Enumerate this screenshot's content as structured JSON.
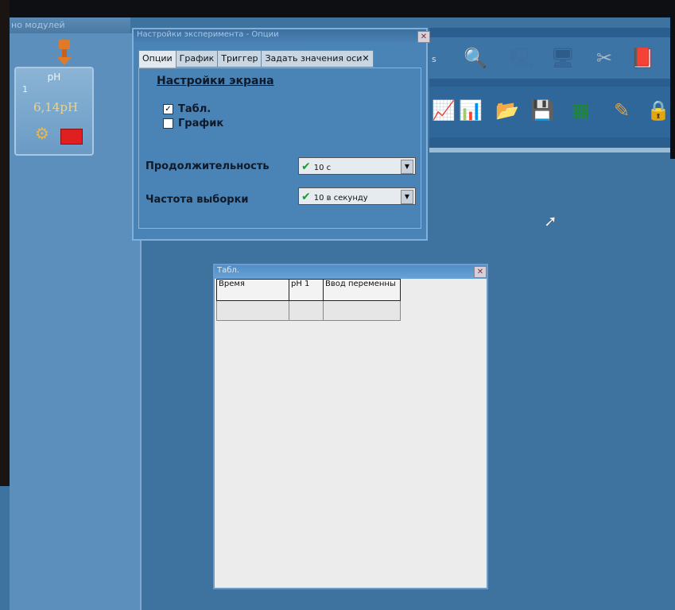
{
  "modules_panel": {
    "title": "но модулей",
    "sensor": {
      "name": "pH",
      "channel": "1",
      "value": "6,14pH"
    }
  },
  "options_dialog": {
    "title": "Настройки эксперимента - Опции",
    "tabs": [
      {
        "label": "Опции",
        "active": true
      },
      {
        "label": "График",
        "active": false
      },
      {
        "label": "Триггер",
        "active": false
      },
      {
        "label": "Задать значения оси",
        "active": false
      }
    ],
    "screen_settings": {
      "heading": "Настройки экрана",
      "table_option": {
        "label": "Табл.",
        "checked": true
      },
      "graph_option": {
        "label": "График",
        "checked": false
      }
    },
    "duration": {
      "label": "Продолжительность",
      "value": "10 с"
    },
    "sample_rate": {
      "label": "Частота выборки",
      "value": "10 в секунду"
    }
  },
  "toolbar": {
    "partial_label": "s",
    "icons": [
      "sensor-search-icon",
      "network-computer-icon",
      "monitor-network-icon",
      "tools-icon",
      "book-icon",
      "chart-icon",
      "chart-marker-icon",
      "open-folder-icon",
      "save-chart-icon",
      "excel-export-icon",
      "chart-eraser-icon",
      "lock-icon"
    ]
  },
  "table_window": {
    "title": "Табл.",
    "columns": [
      "Время",
      "pH 1",
      "Ввод переменны"
    ],
    "rows": [
      [
        "",
        "",
        ""
      ]
    ]
  },
  "colors": {
    "desktop": "#3f739f",
    "dialog": "#4a83b6",
    "sensor_value": "#f3d27a",
    "status_red": "#e02020",
    "valid_check": "#1b9a2e"
  }
}
